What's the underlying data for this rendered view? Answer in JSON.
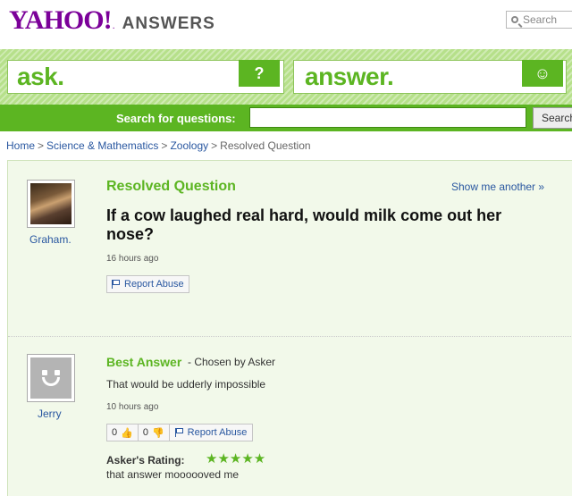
{
  "header": {
    "logo_yahoo": "YAHOO!",
    "logo_dot": ".",
    "logo_answers": "ANSWERS",
    "search_placeholder": "Search"
  },
  "band": {
    "ask_label": "ask.",
    "ask_icon_glyph": "?",
    "answer_label": "answer.",
    "answer_icon_glyph": "☺"
  },
  "searchbar": {
    "label": "Search for questions:",
    "input_value": "",
    "button_label": "Search"
  },
  "breadcrumb": {
    "items": [
      "Home",
      "Science & Mathematics",
      "Zoology"
    ],
    "current": "Resolved Question",
    "separator": ">"
  },
  "question": {
    "status_title": "Resolved Question",
    "show_another": "Show me another »",
    "text": "If a cow laughed real hard, would milk come out her nose?",
    "asker": "Graham.",
    "time": "16 hours ago",
    "report_label": "Report Abuse"
  },
  "best_answer": {
    "title": "Best Answer",
    "chosen_by": "- Chosen by Asker",
    "text": "That would be udderly impossible",
    "answerer": "Jerry",
    "time": "10 hours ago",
    "thumbs_up_count": "0",
    "thumbs_down_count": "0",
    "report_label": "Report Abuse",
    "rating_label": "Asker's Rating:",
    "stars": "★★★★★",
    "rating_value": 5,
    "comment": "that answer moooooved me"
  },
  "colors": {
    "yahoo_purple": "#7b0099",
    "answers_green": "#5cb522",
    "link_blue": "#2957a0"
  }
}
